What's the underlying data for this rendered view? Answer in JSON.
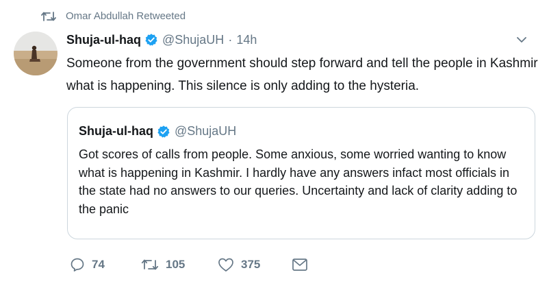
{
  "retweet_context": {
    "text": "Omar Abdullah Retweeted",
    "icon": "retweet-icon"
  },
  "tweet": {
    "author_name": "Shuja-ul-haq",
    "handle": "@ShujaUH",
    "separator": "·",
    "time": "14h",
    "verified": true,
    "text": "Someone from the government should step forward and tell the people in Kashmir what is happening. This silence is only adding to the hysteria."
  },
  "quoted_tweet": {
    "author_name": "Shuja-ul-haq",
    "handle": "@ShujaUH",
    "verified": true,
    "text": "Got scores of calls from people. Some anxious, some worried wanting to know what is happening in Kashmir. I hardly have any answers infact most officials in the state had no answers to our queries. Uncertainty and lack of clarity adding to the panic"
  },
  "actions": {
    "reply_count": "74",
    "retweet_count": "105",
    "like_count": "375"
  },
  "colors": {
    "verified_blue": "#1da1f2",
    "secondary_text": "#657786",
    "border": "#ccd6dd"
  }
}
